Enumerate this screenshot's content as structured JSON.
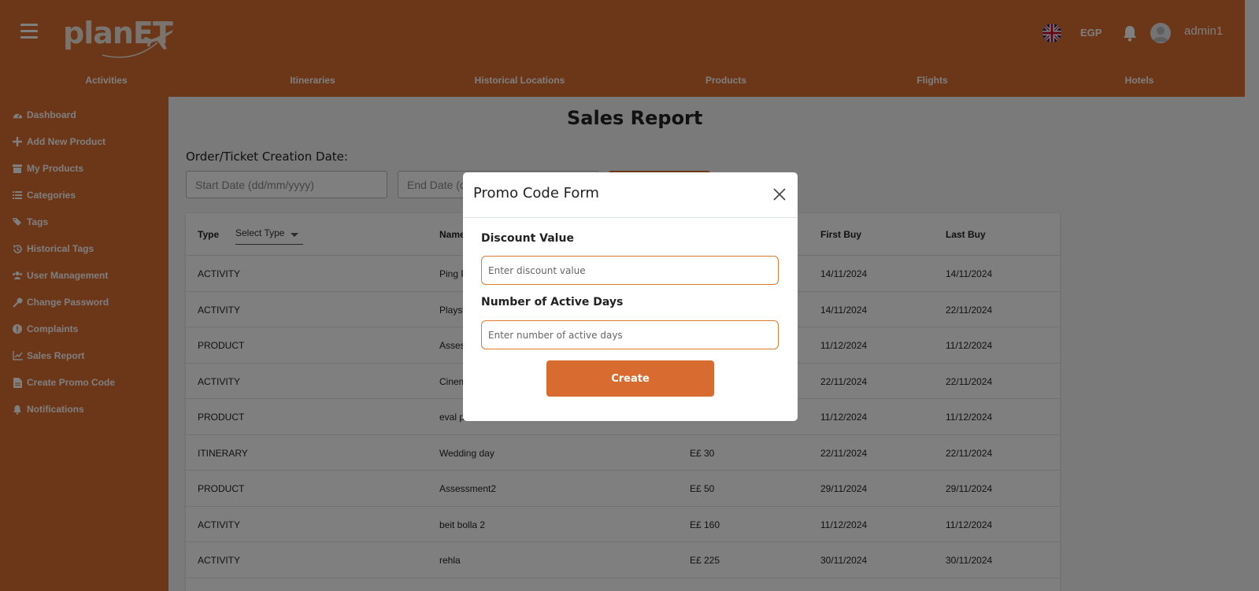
{
  "header": {
    "logo_text": "planET",
    "currency": "EGP",
    "username": "admin1",
    "brand_color": "#d86c30"
  },
  "nav": [
    {
      "label": "Activities"
    },
    {
      "label": "Itineraries"
    },
    {
      "label": "Historical Locations"
    },
    {
      "label": "Products"
    },
    {
      "label": "Flights"
    },
    {
      "label": "Hotels"
    }
  ],
  "sidebar": {
    "items": [
      {
        "label": "Dashboard",
        "icon": "dashboard-icon"
      },
      {
        "label": "Add New Product",
        "icon": "plus-icon"
      },
      {
        "label": "My Products",
        "icon": "box-icon"
      },
      {
        "label": "Categories",
        "icon": "list-icon"
      },
      {
        "label": "Tags",
        "icon": "tags-icon"
      },
      {
        "label": "Historical Tags",
        "icon": "history-icon"
      },
      {
        "label": "User Management",
        "icon": "users-icon"
      },
      {
        "label": "Change Password",
        "icon": "key-icon"
      },
      {
        "label": "Complaints",
        "icon": "alert-icon"
      },
      {
        "label": "Sales Report",
        "icon": "chart-icon"
      },
      {
        "label": "Create Promo Code",
        "icon": "document-icon"
      },
      {
        "label": "Notifications",
        "icon": "bell-icon"
      }
    ]
  },
  "main": {
    "title": "Sales Report",
    "filter_label": "Order/Ticket Creation Date:",
    "start_date_placeholder": "Start Date (dd/mm/yyyy)",
    "end_date_placeholder": "End Date (dd/mm/yyyy)"
  },
  "table": {
    "headers": {
      "type": "Type",
      "select_type": "Select Type",
      "name": "Name",
      "first_buy": "First Buy",
      "last_buy": "Last Buy"
    },
    "rows": [
      {
        "type": "ACTIVITY",
        "name": "Ping Pong",
        "revenue": "",
        "first": "14/11/2024",
        "last": "14/11/2024"
      },
      {
        "type": "ACTIVITY",
        "name": "Playstation",
        "revenue": "",
        "first": "14/11/2024",
        "last": "22/11/2024"
      },
      {
        "type": "PRODUCT",
        "name": "Assessment",
        "revenue": "",
        "first": "11/12/2024",
        "last": "11/12/2024"
      },
      {
        "type": "ACTIVITY",
        "name": "Cinema",
        "revenue": "",
        "first": "22/11/2024",
        "last": "22/11/2024"
      },
      {
        "type": "PRODUCT",
        "name": "eval product",
        "revenue": "",
        "first": "11/12/2024",
        "last": "11/12/2024"
      },
      {
        "type": "ITINERARY",
        "name": "Wedding day",
        "revenue": "E£ 30",
        "first": "22/11/2024",
        "last": "22/11/2024"
      },
      {
        "type": "PRODUCT",
        "name": "Assessment2",
        "revenue": "E£ 50",
        "first": "29/11/2024",
        "last": "29/11/2024"
      },
      {
        "type": "ACTIVITY",
        "name": "beit bolla 2",
        "revenue": "E£ 160",
        "first": "11/12/2024",
        "last": "11/12/2024"
      },
      {
        "type": "ACTIVITY",
        "name": "rehla",
        "revenue": "E£ 225",
        "first": "30/11/2024",
        "last": "30/11/2024"
      }
    ]
  },
  "modal": {
    "title": "Promo Code Form",
    "discount_label": "Discount Value",
    "discount_placeholder": "Enter discount value",
    "days_label": "Number of Active Days",
    "days_placeholder": "Enter number of active days",
    "create_label": "Create"
  }
}
